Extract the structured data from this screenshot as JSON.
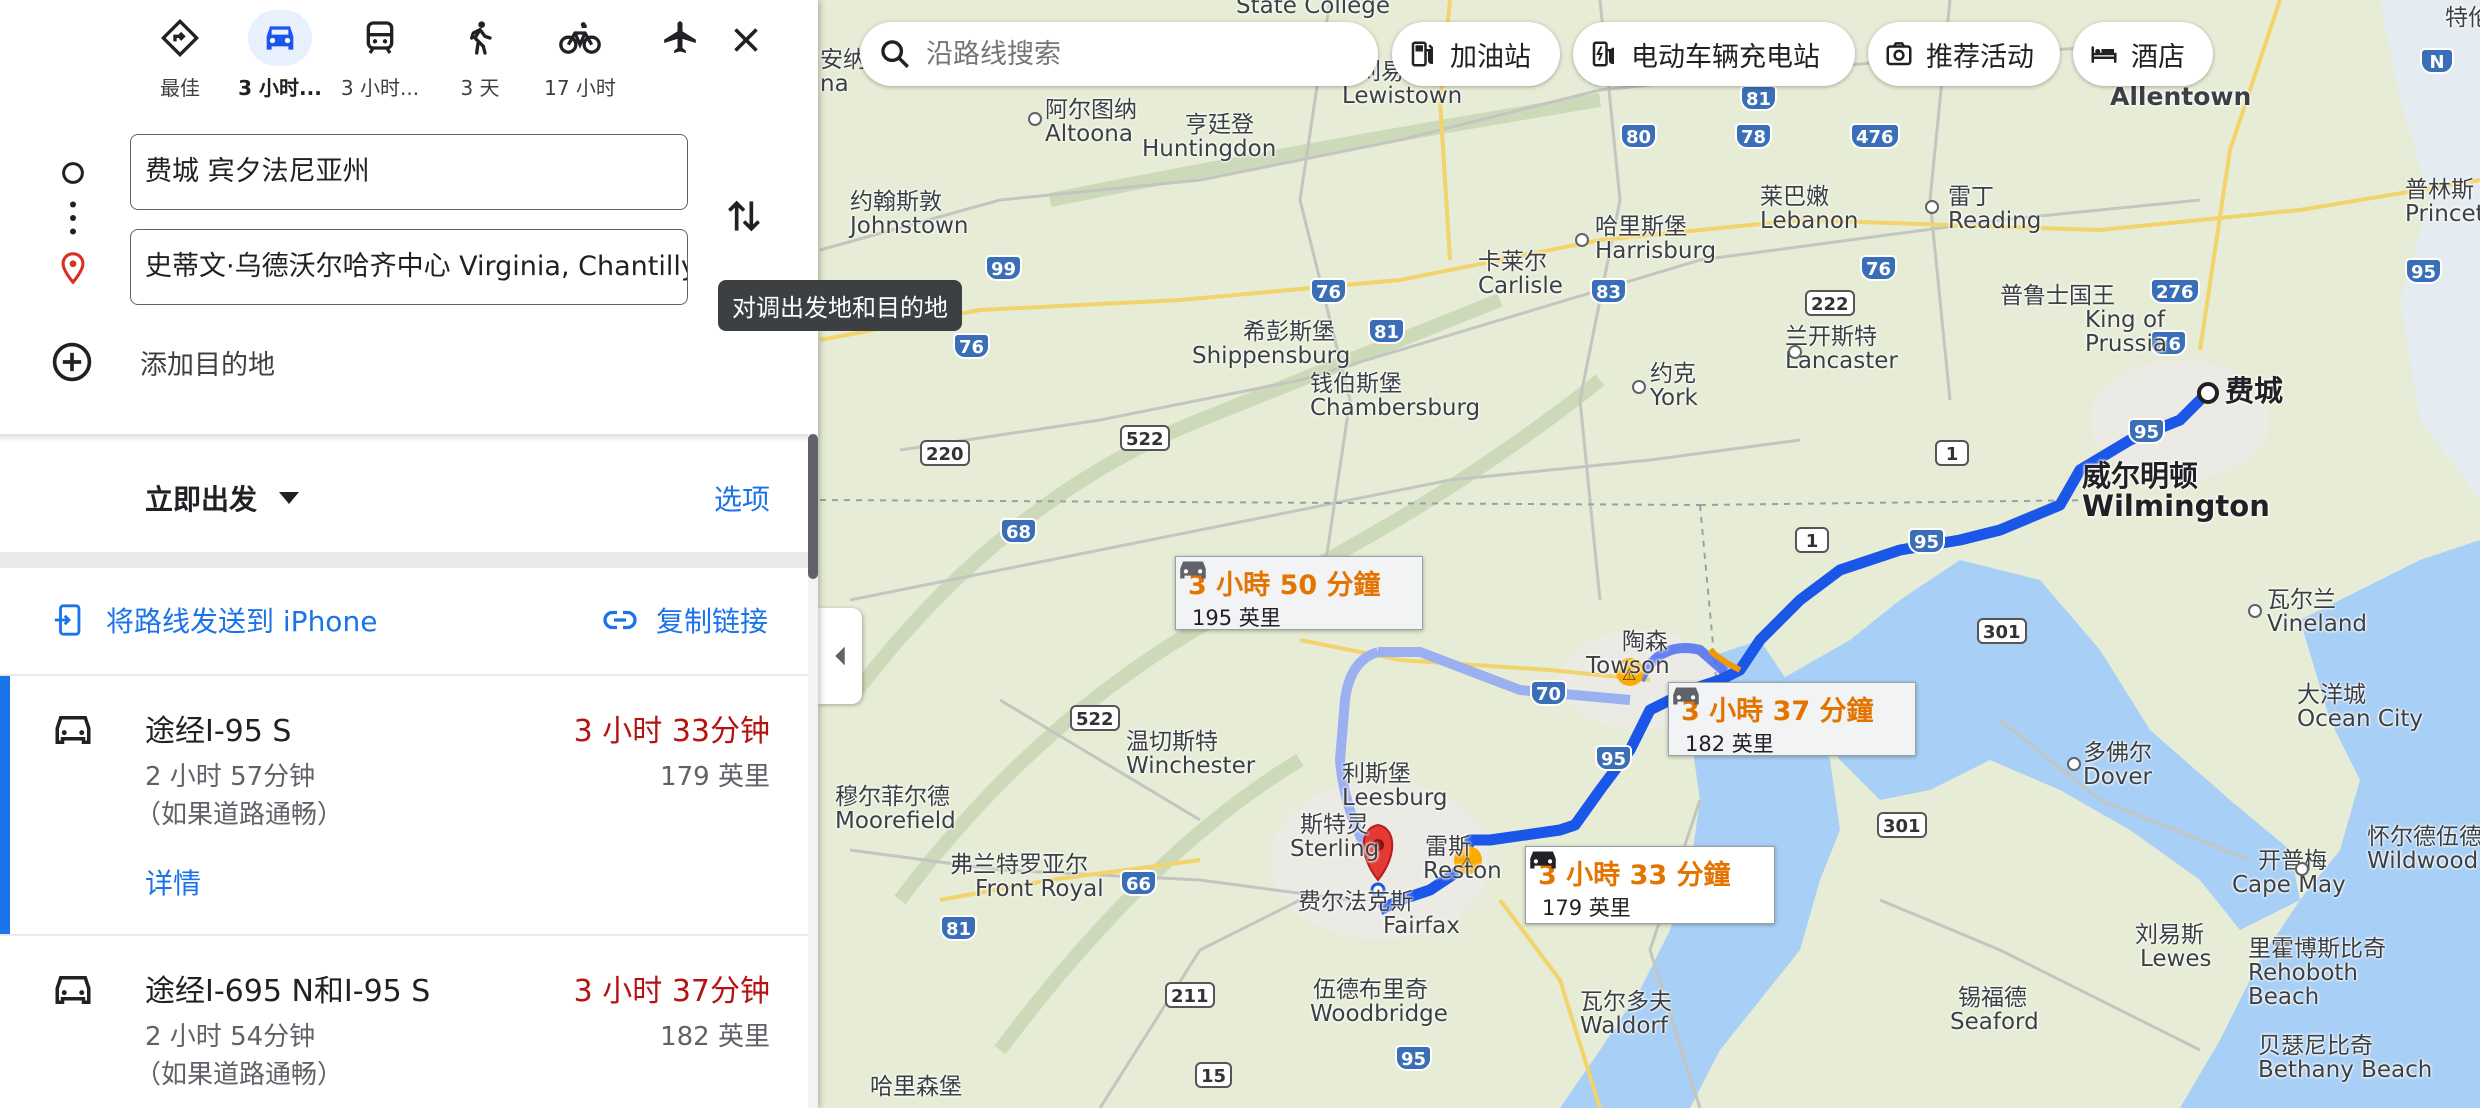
{
  "modes": [
    {
      "label": "最佳",
      "icon": "best-route-icon"
    },
    {
      "label": "3 小时...",
      "icon": "car-icon"
    },
    {
      "label": "3 小时...",
      "icon": "transit-icon"
    },
    {
      "label": "3 天",
      "icon": "walk-icon"
    },
    {
      "label": "17 小时",
      "icon": "bicycle-icon"
    },
    {
      "label": "",
      "icon": "flight-icon"
    }
  ],
  "origin": {
    "value": "费城 宾夕法尼亚州"
  },
  "destination": {
    "value": "史蒂文·乌德沃尔哈齐中心 Virginia, Chantilly"
  },
  "add_destination": "添加目的地",
  "swap_tooltip": "对调出发地和目的地",
  "depart": {
    "label": "立即出发",
    "options": "选项"
  },
  "share": {
    "send_to_phone": "将路线发送到 iPhone",
    "copy_link": "复制链接"
  },
  "routes": [
    {
      "name": "途经I-95 S",
      "time": "3 小时 33分钟",
      "base_time": "2 小时 57分钟",
      "note": "（如果道路通畅）",
      "distance": "179 英里",
      "details": "详情"
    },
    {
      "name": "途经I-695 N和I-95 S",
      "time": "3 小时 37分钟",
      "base_time": "2 小时 54分钟",
      "note": "（如果道路通畅）",
      "distance": "182 英里"
    }
  ],
  "search": {
    "placeholder": "沿路线搜索"
  },
  "chips": [
    {
      "label": "加油站",
      "icon": "gas-station-icon"
    },
    {
      "label": "电动车辆充电站",
      "icon": "ev-charger-icon"
    },
    {
      "label": "推荐活动",
      "icon": "camera-icon"
    },
    {
      "label": "酒店",
      "icon": "hotel-icon"
    }
  ],
  "callouts": [
    {
      "time": "3 小時 50 分鐘",
      "distance": "195 英里"
    },
    {
      "time": "3 小時 37 分鐘",
      "distance": "182 英里"
    },
    {
      "time": "3 小時 33 分鐘",
      "distance": "179 英里"
    }
  ],
  "map_labels": {
    "state_college": "State College",
    "anshida": "安纳",
    "anshida2": "na",
    "lewistown_cn": "刘易斯敦",
    "lewistown": "Lewistown",
    "altoona_cn": "阿尔图纳",
    "altoona": "Altoona",
    "huntingdon_cn": "亨廷登",
    "huntingdon": "Huntingdon",
    "johnstown_cn": "约翰斯敦",
    "johnstown": "Johnstown",
    "harrisburg_cn": "哈里斯堡",
    "harrisburg": "Harrisburg",
    "lebanon_cn": "莱巴嫩",
    "lebanon": "Lebanon",
    "reading_cn": "雷丁",
    "reading": "Reading",
    "allentown": "Allentown",
    "carlisle_cn": "卡莱尔",
    "carlisle": "Carlisle",
    "king_cn": "普鲁士国王",
    "king1": "King of",
    "king2": "Prussia",
    "lancaster_cn": "兰开斯特",
    "lancaster": "Lancaster",
    "shippensburg_cn": "希彭斯堡",
    "shippensburg": "Shippensburg",
    "york_cn": "约克",
    "york": "York",
    "chambersburg_cn": "钱伯斯堡",
    "chambersburg": "Chambersburg",
    "philadelphia": "费城",
    "wilmington_cn": "威尔明顿",
    "wilmington": "Wilmington",
    "vineland_cn": "瓦尔兰",
    "vineland": "Vineland",
    "towson_cn": "陶森",
    "towson": "Towson",
    "atlantic_cn": "大洋城",
    "atlantic": "Ocean City",
    "dover_cn": "多佛尔",
    "dover": "Dover",
    "winchester_cn": "温切斯特",
    "winchester": "Winchester",
    "leesburg_cn": "利斯堡",
    "leesburg": "Leesburg",
    "moorefield_cn": "穆尔菲尔德",
    "moorefield": "Moorefield",
    "sterling_cn": "斯特灵",
    "sterling": "Sterling",
    "reston_cn": "雷斯",
    "reston": "Reston",
    "front_royal_cn": "弗兰特罗亚尔",
    "front_royal": "Front Royal",
    "fairfax_cn": "费尔法克斯",
    "fairfax": "Fairfax",
    "capemay_cn": "开普梅",
    "capemay": "Cape May",
    "wildwood_cn": "怀尔德伍德",
    "wildwood": "Wildwood",
    "woodbridge_cn": "伍德布里奇",
    "woodbridge": "Woodbridge",
    "waldorf_cn": "瓦尔多夫",
    "waldorf": "Waldorf",
    "lewes_cn": "刘易斯",
    "lewes": "Lewes",
    "rehoboth_cn": "里霍博斯比奇",
    "rehoboth1": "Rehoboth",
    "rehoboth2": "Beach",
    "seaford_cn": "锡福德",
    "seaford": "Seaford",
    "bethany_cn": "贝瑟尼比奇",
    "bethany": "Bethany Beach",
    "harrisonburg_cn": "哈里森堡",
    "princeton_cn": "普林斯",
    "princeton": "Princet",
    "trenton_cn": "特伦"
  }
}
